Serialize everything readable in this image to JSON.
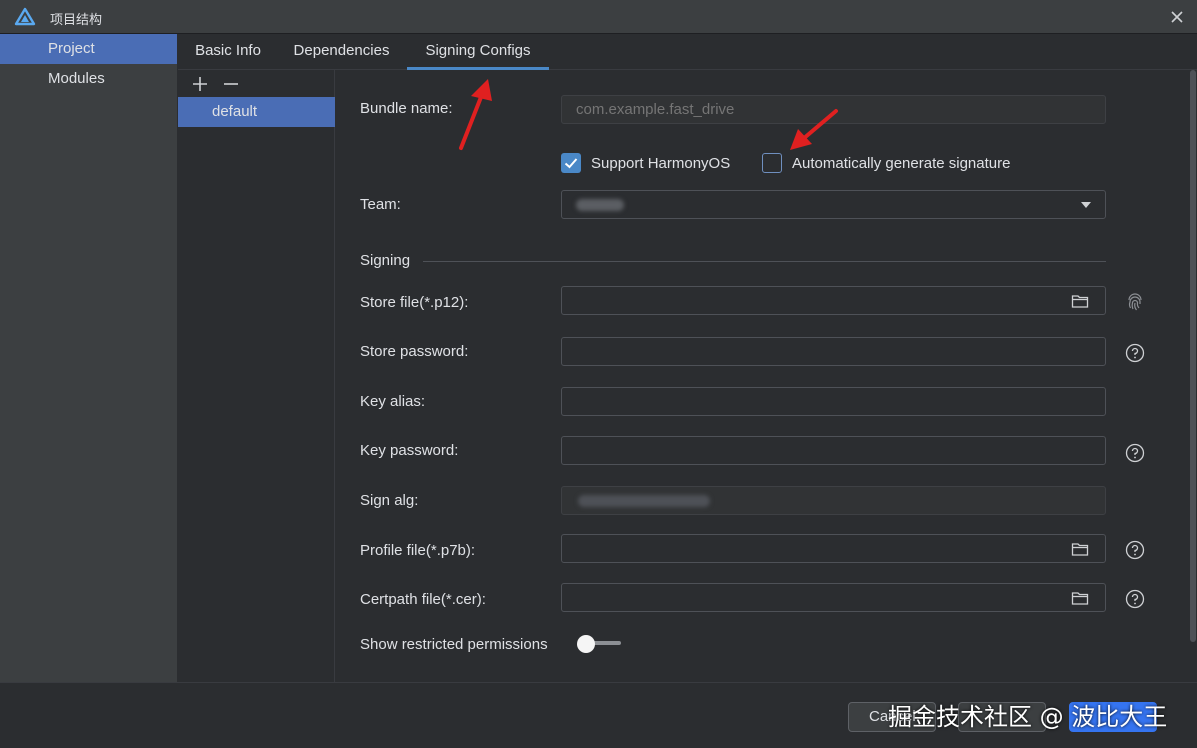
{
  "window": {
    "title": "项目结构",
    "logo_icon": "deveco-logo-icon",
    "close_icon": "close-icon"
  },
  "nav": {
    "items": [
      {
        "label": "Project",
        "selected": true
      },
      {
        "label": "Modules",
        "selected": false
      }
    ]
  },
  "tabs": [
    {
      "label": "Basic Info"
    },
    {
      "label": "Dependencies"
    },
    {
      "label": "Signing Configs",
      "active": true
    }
  ],
  "configs": {
    "add_icon": "plus-icon",
    "remove_icon": "minus-icon",
    "items": [
      {
        "label": "default"
      }
    ]
  },
  "form": {
    "bundle_name": {
      "label": "Bundle name:",
      "placeholder": "com.example.fast_drive"
    },
    "support_harmonyos": {
      "label": "Support HarmonyOS",
      "checked": true
    },
    "auto_sign": {
      "label": "Automatically generate signature",
      "checked": false
    },
    "team": {
      "label": "Team:"
    },
    "signing_section": "Signing",
    "store_file": {
      "label": "Store file(*.p12):"
    },
    "store_password": {
      "label": "Store password:"
    },
    "key_alias": {
      "label": "Key alias:"
    },
    "key_password": {
      "label": "Key password:"
    },
    "sign_alg": {
      "label": "Sign alg:"
    },
    "profile_file": {
      "label": "Profile file(*.p7b):"
    },
    "certpath_file": {
      "label": "Certpath file(*.cer):"
    },
    "show_restricted": {
      "label": "Show restricted permissions",
      "on": false
    }
  },
  "footer": {
    "cancel_label": "Cancel"
  },
  "watermark": "掘金技术社区 @ 波比大王",
  "colors": {
    "accent": "#4a88c7",
    "selection": "#4a6db5",
    "annotation_arrow": "#e02020"
  }
}
